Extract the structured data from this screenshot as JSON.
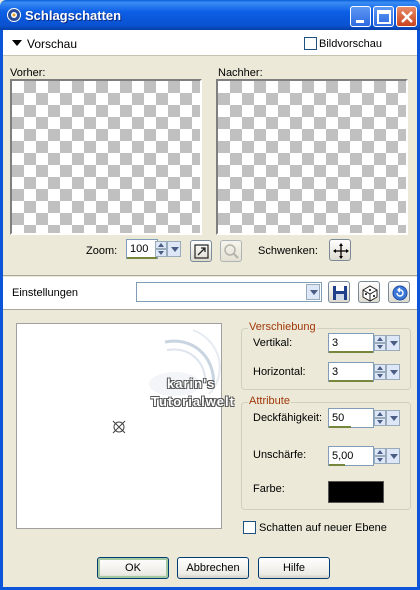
{
  "window": {
    "title": "Schlagschatten"
  },
  "preview": {
    "toggle_label": "Vorschau",
    "bild_label": "Bildvorschau",
    "bild_checked": false,
    "before_label": "Vorher:",
    "after_label": "Nachher:"
  },
  "zoom": {
    "label": "Zoom:",
    "value": "100",
    "pan_label": "Schwenken:"
  },
  "settings": {
    "label": "Einstellungen",
    "value": ""
  },
  "offset": {
    "title": "Verschiebung",
    "vertical_label": "Vertikal:",
    "vertical_value": "3",
    "horizontal_label": "Horizontal:",
    "horizontal_value": "3"
  },
  "attributes": {
    "title": "Attribute",
    "opacity_label": "Deckfähigkeit:",
    "opacity_value": "50",
    "blur_label": "Unschärfe:",
    "blur_value": "5,00",
    "color_label": "Farbe:",
    "color": "#000000"
  },
  "new_layer": {
    "label": "Schatten auf neuer Ebene",
    "checked": false
  },
  "watermark": {
    "line1": "karin's",
    "line2": "Tutorialwelt"
  },
  "buttons": {
    "ok": "OK",
    "cancel": "Abbrechen",
    "help": "Hilfe"
  },
  "colors": {
    "titlebar": "#0a52d0",
    "group_title": "#a0380a",
    "dialog_bg": "#ece9d8"
  },
  "icons": [
    "app-icon",
    "minimize-icon",
    "maximize-icon",
    "close-icon",
    "fit-icon",
    "zoom-disabled-icon",
    "pan-icon",
    "save-icon",
    "dice-icon",
    "reset-icon"
  ]
}
